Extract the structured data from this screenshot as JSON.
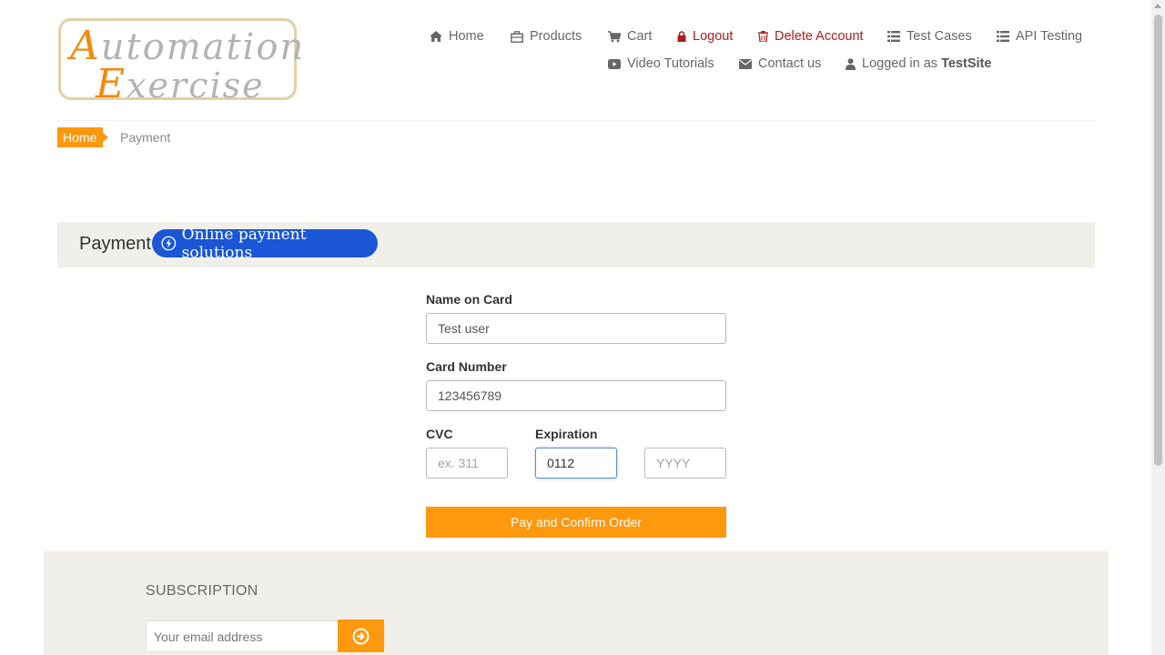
{
  "logo": {
    "line1_cap": "A",
    "line1_rest": "utomation",
    "line2_cap": "E",
    "line2_rest": "xercise"
  },
  "nav": {
    "home": "Home",
    "products": "Products",
    "cart": "Cart",
    "logout": "Logout",
    "delete_account": "Delete Account",
    "test_cases": "Test Cases",
    "api_testing": "API Testing",
    "video_tutorials": "Video Tutorials",
    "contact_us": "Contact us",
    "logged_in_prefix": "Logged in as",
    "username": "TestSite"
  },
  "breadcrumb": {
    "home": "Home",
    "current": "Payment"
  },
  "payment": {
    "title": "Payment",
    "badge": "Online payment solutions"
  },
  "form": {
    "name_label": "Name on Card",
    "name_value": "Test user",
    "card_label": "Card Number",
    "card_value": "123456789",
    "cvc_label": "CVC",
    "cvc_placeholder": "ex. 311",
    "expiration_label": "Expiration",
    "exp_month_value": "0112",
    "exp_year_placeholder": "YYYY",
    "submit_label": "Pay and Confirm Order"
  },
  "footer": {
    "subscription_title": "SUBSCRIPTION",
    "email_placeholder": "Your email address"
  },
  "colors": {
    "accent": "#fe980f",
    "danger": "#b11b1b",
    "badge": "#1a56d6",
    "band": "#f0efea"
  }
}
